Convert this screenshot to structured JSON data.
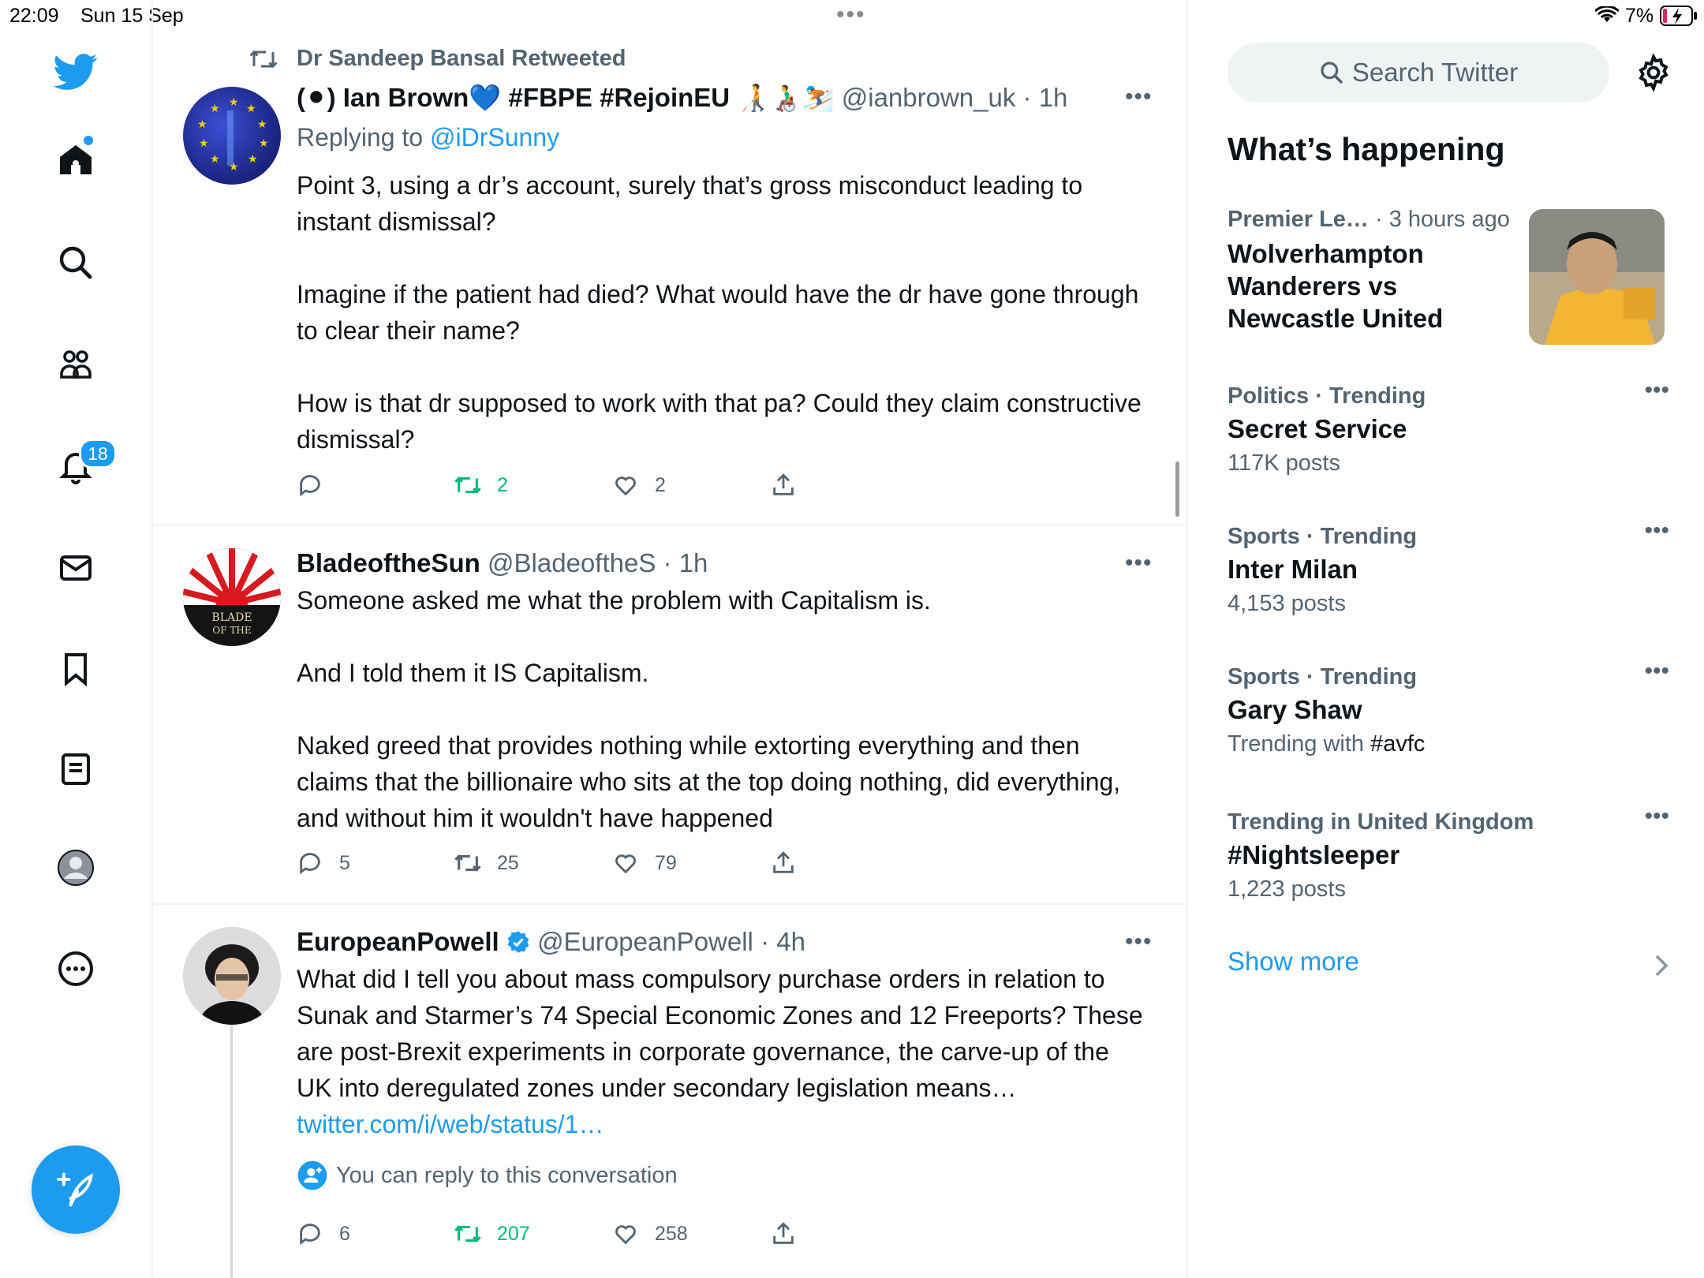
{
  "status_bar": {
    "time": "22:09",
    "date": "Sun 15 Sep",
    "battery": "7%"
  },
  "nav": {
    "notification_count": "18"
  },
  "timeline": {
    "tweets": [
      {
        "retweet_label": "Dr Sandeep Bansal Retweeted",
        "name": "(⚫) Ian Brown💙 #FBPE #RejoinEU 🧑‍🦯👨‍🦽⛷️",
        "handle": "@ianbrown_uk",
        "time": "· 1h",
        "replying_prefix": "Replying to",
        "replying_to": "@iDrSunny",
        "body": "Point 3, using a dr’s account, surely that’s gross misconduct leading to instant dismissal?\n\nImagine if the patient had died? What would have the dr have gone through to clear their name?\n\nHow is that dr supposed to work with that pa? Could they claim constructive dismissal?",
        "replies": "",
        "retweets": "2",
        "likes": "2"
      },
      {
        "name": "BladeoftheSun",
        "handle": "@BladeoftheS",
        "time": "· 1h",
        "avatar_text": "BLADE OF THE SUN",
        "body": "Someone asked me what the problem with Capitalism is.\n\nAnd I told them it IS Capitalism.\n\nNaked greed that provides nothing while extorting everything and then claims that the billionaire who sits at the top doing nothing, did everything, and without him it wouldn't have happened",
        "replies": "5",
        "retweets": "25",
        "likes": "79"
      },
      {
        "name": "EuropeanPowell",
        "handle": "@EuropeanPowell",
        "time": "· 4h",
        "body": "What did I tell you about mass compulsory purchase orders in relation to Sunak and Starmer’s 74 Special Economic Zones and 12 Freeports? These are post-Brexit experiments in corporate governance, the carve-up of the UK into deregulated zones under secondary legislation means… ",
        "link": "twitter.com/i/web/status/1…",
        "reply_notice": "You can reply to this conversation",
        "replies": "6",
        "retweets": "207",
        "likes": "258"
      }
    ]
  },
  "sidebar": {
    "search_placeholder": "Search Twitter",
    "heading": "What’s happening",
    "featured": {
      "category": "Premier Le…",
      "time": "· 3 hours ago",
      "title": "Wolverhampton Wanderers vs Newcastle United"
    },
    "trends": [
      {
        "meta": "Politics · Trending",
        "title": "Secret Service",
        "sub": "117K posts"
      },
      {
        "meta": "Sports · Trending",
        "title": "Inter Milan",
        "sub": "4,153 posts"
      },
      {
        "meta": "Sports · Trending",
        "title": "Gary Shaw",
        "sub_prefix": "Trending with ",
        "sub_tag": "#avfc"
      },
      {
        "meta": "Trending in United Kingdom",
        "title": "#Nightsleeper",
        "sub": "1,223 posts"
      }
    ],
    "show_more": "Show more"
  },
  "colors": {
    "accent": "#1d9bf0",
    "retweet_green": "#00ba7c",
    "muted": "#536471"
  }
}
